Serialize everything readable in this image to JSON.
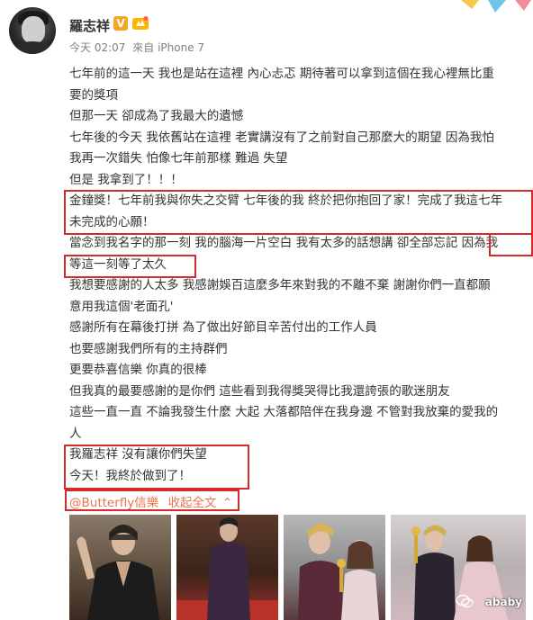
{
  "post": {
    "username": "羅志祥",
    "verified": "V",
    "time": "今天 02:07",
    "source_prefix": "來自",
    "source": "iPhone 7"
  },
  "content": {
    "lines": [
      "七年前的這一天 我也是站在這裡 內心忐忑 期待著可以拿到這個在我心裡無比重",
      "要的獎項",
      "但那一天 卻成為了我最大的遺憾",
      "七年後的今天 我依舊站在這裡 老實講沒有了之前對自己那麼大的期望 因為我怕",
      "我再一次錯失 怕像七年前那樣 難過 失望",
      "但是 我拿到了！！！",
      "金鐘獎！七年前我與你失之交臂 七年後的我 終於把你抱回了家！完成了我這七年",
      "未完成的心願！",
      "當念到我名字的那一刻 我的腦海一片空白 我有太多的話想講 卻全部忘記 因為我",
      "等這一刻等了太久",
      "我想要感謝的人太多 我感謝娛百這麼多年來對我的不離不棄 謝謝你們一直都願",
      "意用我這個'老面孔'",
      "感謝所有在幕後打拼 為了做出好節目辛苦付出的工作人員",
      "也要感謝我們所有的主持群們",
      "更要恭喜信樂 你真的很棒",
      "但我真的最要感謝的是你們 這些看到我得獎哭得比我還誇張的歌迷朋友",
      "這些一直一直 不論我發生什麼 大起 大落都陪伴在我身邊 不管對我放棄的愛我的",
      "人",
      "我羅志祥 沒有讓你們失望",
      "今天！我終於做到了！"
    ],
    "mention": "@Butterfly信樂",
    "collapse_label": "收起全文",
    "collapse_arrow": "⌃"
  },
  "watermark": "ababy",
  "colors": {
    "highlight_box": "#d92a2a",
    "link": "#eb7350",
    "badge": "#f5a623"
  },
  "icons": [
    "verified-badge-icon",
    "level-badge-icon",
    "wechat-icon"
  ]
}
